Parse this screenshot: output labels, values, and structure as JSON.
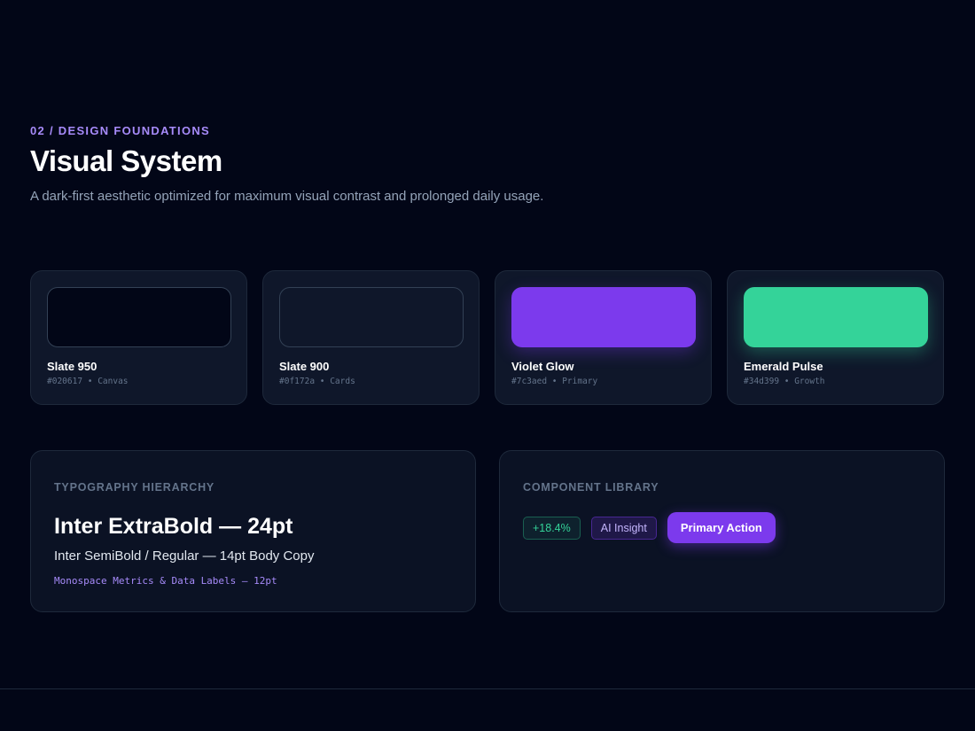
{
  "header": {
    "eyebrow": "02 / DESIGN FOUNDATIONS",
    "title": "Visual System",
    "subtitle": "A dark-first aesthetic optimized for maximum visual contrast and prolonged daily usage."
  },
  "palette": [
    {
      "name": "Slate 950",
      "meta": "#020617 • Canvas",
      "color": "#020617"
    },
    {
      "name": "Slate 900",
      "meta": "#0f172a • Cards",
      "color": "#0f172a"
    },
    {
      "name": "Violet Glow",
      "meta": "#7c3aed • Primary",
      "color": "#7c3aed"
    },
    {
      "name": "Emerald Pulse",
      "meta": "#34d399 • Growth",
      "color": "#34d399"
    }
  ],
  "typography": {
    "label": "TYPOGRAPHY HIERARCHY",
    "heading": "Inter ExtraBold — 24pt",
    "body": "Inter SemiBold / Regular — 14pt Body Copy",
    "mono": "Monospace Metrics & Data Labels — 12pt"
  },
  "components": {
    "label": "COMPONENT LIBRARY",
    "growth_chip": "+18.4%",
    "ai_chip": "AI Insight",
    "primary_button": "Primary Action"
  }
}
